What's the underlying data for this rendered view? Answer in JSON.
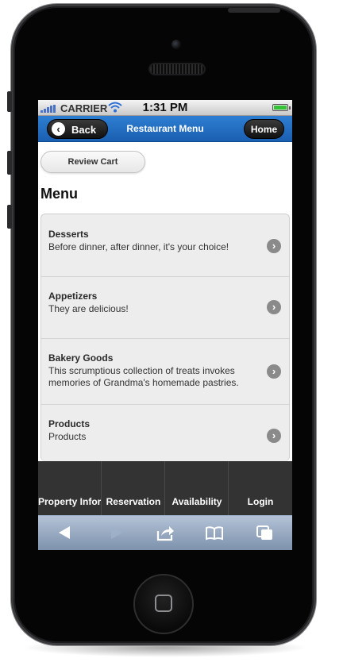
{
  "status_bar": {
    "carrier": "CARRIER",
    "time": "1:31 PM"
  },
  "header": {
    "back_label": "Back",
    "title": "Restaurant Menu",
    "home_label": "Home"
  },
  "cart_button": "Review Cart",
  "menu_title": "Menu",
  "menu_items": [
    {
      "name": "Desserts",
      "description": "Before dinner, after dinner, it's your choice!"
    },
    {
      "name": "Appetizers",
      "description": "They are delicious!"
    },
    {
      "name": "Bakery Goods",
      "description": "This scrumptious collection of treats invokes memories of Grandma's homemade pastries."
    },
    {
      "name": "Products",
      "description": "Products"
    }
  ],
  "nav_tabs": [
    "Property Information",
    "Reservation",
    "Availability",
    "Login"
  ],
  "browser_toolbar": [
    "back-icon",
    "forward-icon",
    "share-icon",
    "bookmarks-icon",
    "tabs-icon"
  ],
  "colors": {
    "header_blue": "#1f67bd",
    "nav_bg": "#333333",
    "toolbar_blue": "#8ea1bb"
  }
}
